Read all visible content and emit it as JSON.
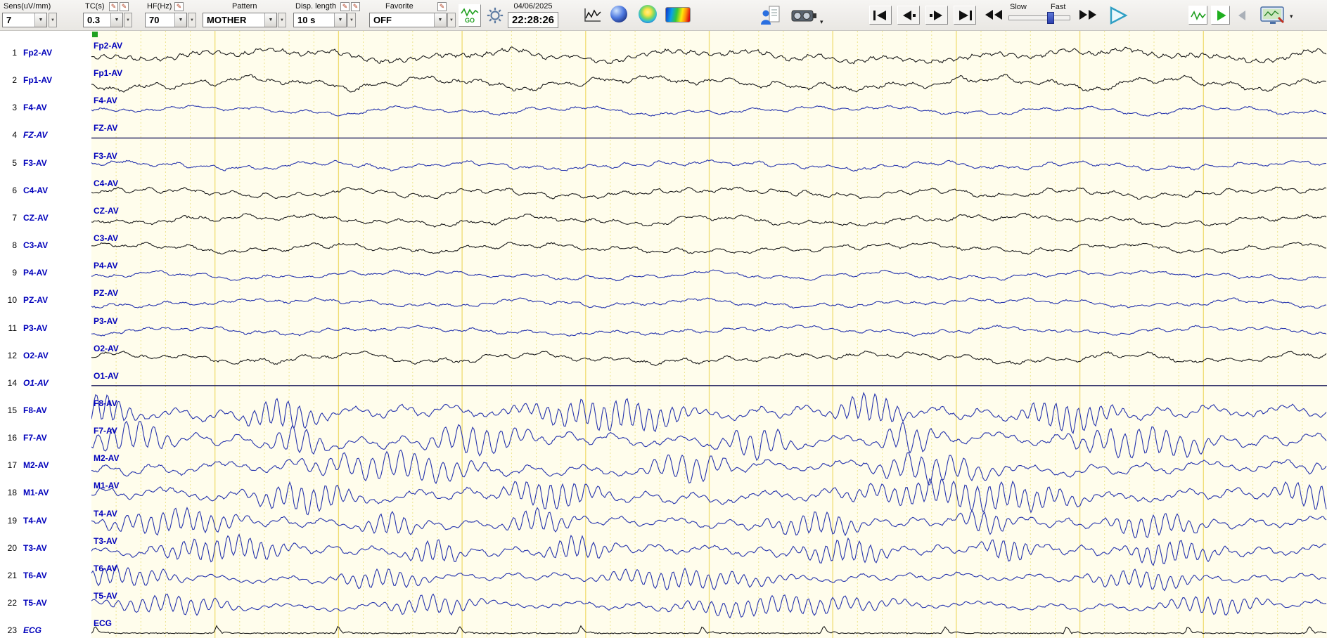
{
  "toolbar": {
    "sens": {
      "label": "Sens(uV/mm)",
      "value": "7"
    },
    "tc": {
      "label": "TC(s)",
      "value": "0.3"
    },
    "hf": {
      "label": "HF(Hz)",
      "value": "70"
    },
    "pattern": {
      "label": "Pattern",
      "value": "MOTHER"
    },
    "disp_length": {
      "label": "Disp. length",
      "value": "10 s"
    },
    "favorite": {
      "label": "Favorite",
      "value": "OFF"
    },
    "go_label": "GO",
    "date": "04/06/2025",
    "time": "22:28:26",
    "slider": {
      "slow_label": "Slow",
      "fast_label": "Fast",
      "position_pct": 70
    }
  },
  "icons": {
    "edit-pencil-icon": "✎",
    "combo-arrow-icon": "▼",
    "dropdown-icon": "▾"
  },
  "trace_area": {
    "display_seconds": 10,
    "bg_color": "#FFFDEC",
    "grid_major_color": "#EFDC72",
    "grid_minor_color": "#EDE48E",
    "trace_black": "#1c1c1c",
    "trace_blue": "#2634ad",
    "flat_color": "#1a1a5a",
    "label_color": "#0000BB",
    "marker_color": "#21A121"
  },
  "channels": [
    {
      "num": "1",
      "label": "Fp2-AV",
      "italic": false,
      "color": "black",
      "kind": "eeg",
      "amp": 11
    },
    {
      "num": "2",
      "label": "Fp1-AV",
      "italic": false,
      "color": "black",
      "kind": "eeg",
      "amp": 11
    },
    {
      "num": "3",
      "label": "F4-AV",
      "italic": false,
      "color": "blue",
      "kind": "eeg",
      "amp": 7
    },
    {
      "num": "4",
      "label": "FZ-AV",
      "italic": true,
      "color": "blue",
      "kind": "flat",
      "amp": 0
    },
    {
      "num": "5",
      "label": "F3-AV",
      "italic": false,
      "color": "blue",
      "kind": "eeg",
      "amp": 7
    },
    {
      "num": "6",
      "label": "C4-AV",
      "italic": false,
      "color": "black",
      "kind": "eeg",
      "amp": 8
    },
    {
      "num": "7",
      "label": "CZ-AV",
      "italic": false,
      "color": "black",
      "kind": "eeg",
      "amp": 9
    },
    {
      "num": "8",
      "label": "C3-AV",
      "italic": false,
      "color": "black",
      "kind": "eeg",
      "amp": 8
    },
    {
      "num": "9",
      "label": "P4-AV",
      "italic": false,
      "color": "blue",
      "kind": "eeg",
      "amp": 7
    },
    {
      "num": "10",
      "label": "PZ-AV",
      "italic": false,
      "color": "blue",
      "kind": "eeg",
      "amp": 7
    },
    {
      "num": "11",
      "label": "P3-AV",
      "italic": false,
      "color": "blue",
      "kind": "eeg",
      "amp": 7
    },
    {
      "num": "12",
      "label": "O2-AV",
      "italic": false,
      "color": "black",
      "kind": "eeg",
      "amp": 9
    },
    {
      "num": "14",
      "label": "O1-AV",
      "italic": true,
      "color": "blue",
      "kind": "flat",
      "amp": 0
    },
    {
      "num": "15",
      "label": "F8-AV",
      "italic": false,
      "color": "blue",
      "kind": "alpha",
      "amp": 19
    },
    {
      "num": "16",
      "label": "F7-AV",
      "italic": false,
      "color": "blue",
      "kind": "alpha",
      "amp": 19
    },
    {
      "num": "17",
      "label": "M2-AV",
      "italic": false,
      "color": "blue",
      "kind": "alpha",
      "amp": 18
    },
    {
      "num": "18",
      "label": "M1-AV",
      "italic": false,
      "color": "blue",
      "kind": "alpha",
      "amp": 18
    },
    {
      "num": "19",
      "label": "T4-AV",
      "italic": false,
      "color": "blue",
      "kind": "alpha",
      "amp": 15
    },
    {
      "num": "20",
      "label": "T3-AV",
      "italic": false,
      "color": "blue",
      "kind": "alpha",
      "amp": 15
    },
    {
      "num": "21",
      "label": "T6-AV",
      "italic": false,
      "color": "blue",
      "kind": "alpha",
      "amp": 12
    },
    {
      "num": "22",
      "label": "T5-AV",
      "italic": false,
      "color": "blue",
      "kind": "alpha",
      "amp": 12
    },
    {
      "num": "23",
      "label": "ECG",
      "italic": true,
      "color": "black",
      "kind": "ecg",
      "amp": 10
    }
  ]
}
